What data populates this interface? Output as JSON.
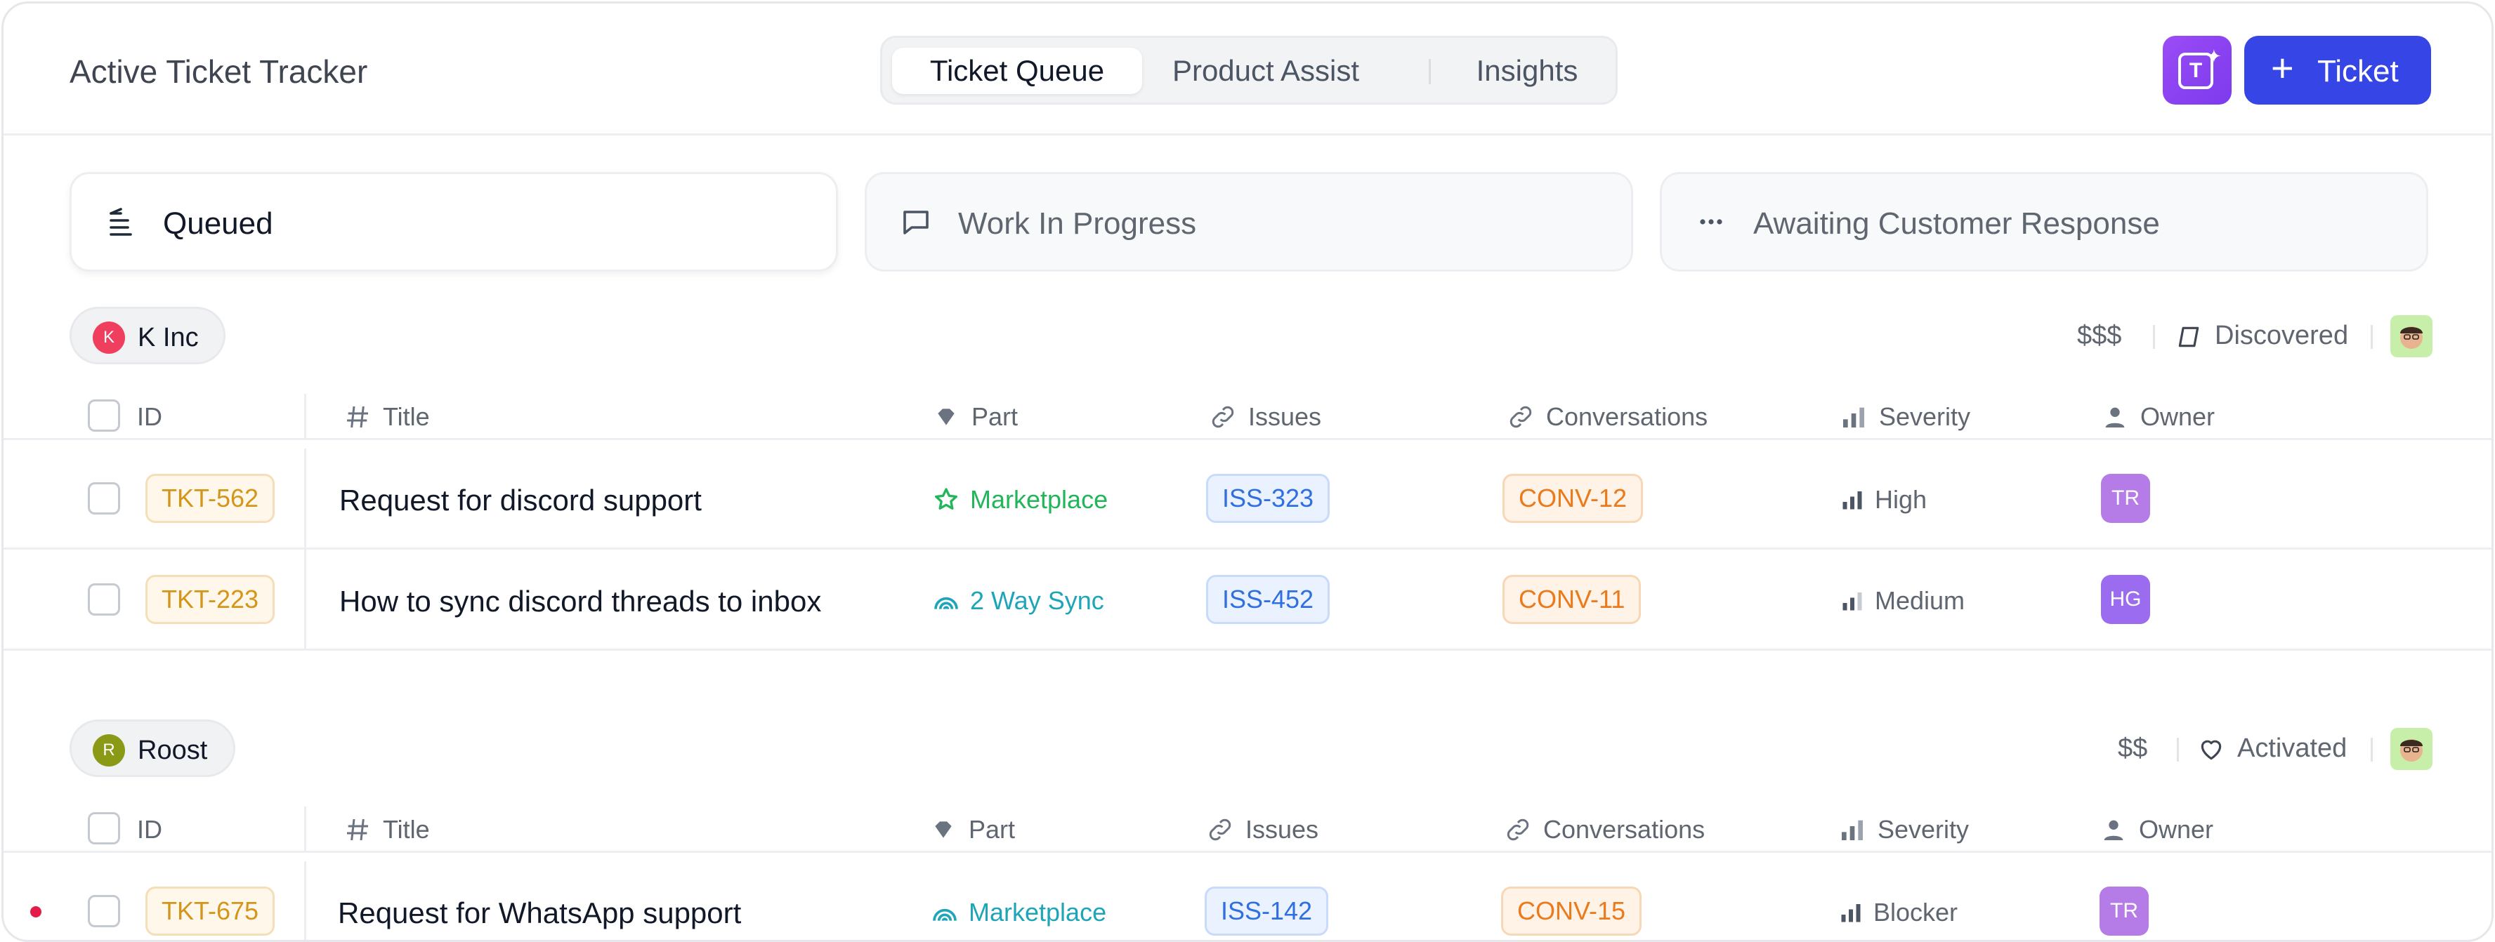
{
  "app_title": "Active Ticket Tracker",
  "tabs": [
    {
      "label": "Ticket Queue",
      "active": true
    },
    {
      "label": "Product Assist",
      "active": false
    },
    {
      "label": "Insights",
      "active": false
    }
  ],
  "ai_button": {
    "letter": "T",
    "icon": "sparkle-icon"
  },
  "new_ticket_button": {
    "icon": "plus-icon",
    "label": "Ticket"
  },
  "stages": [
    {
      "label": "Queued",
      "icon": "list-icon",
      "active": true
    },
    {
      "label": "Work In Progress",
      "icon": "chat-bubble-icon",
      "active": false
    },
    {
      "label": "Awaiting Customer Response",
      "icon": "ellipsis-icon",
      "active": false
    }
  ],
  "columns": [
    "ID",
    "Title",
    "Part",
    "Issues",
    "Conversations",
    "Severity",
    "Owner"
  ],
  "groups": [
    {
      "account": "K Inc",
      "avatar_letter": "K",
      "avatar_color": "#f03e5e",
      "tier": "$$$",
      "status": "Discovered",
      "status_icon": "tag-icon",
      "tickets": [
        {
          "id": "TKT-562",
          "title": "Request for discord support",
          "part": "Marketplace",
          "part_icon": "star-icon",
          "part_color": "#22b55a",
          "issue": "ISS-323",
          "conversation": "CONV-12",
          "severity": "High",
          "owner": "TR",
          "owner_color": "#b57be6"
        },
        {
          "id": "TKT-223",
          "title": "How to sync discord threads to inbox",
          "part": "2 Way Sync",
          "part_icon": "rainbow-icon",
          "part_color": "#1ea5b8",
          "issue": "ISS-452",
          "conversation": "CONV-11",
          "severity": "Medium",
          "owner": "HG",
          "owner_color": "#9c6cf0"
        }
      ]
    },
    {
      "account": "Roost",
      "avatar_letter": "R",
      "avatar_color": "#8a9a16",
      "tier": "$$",
      "status": "Activated",
      "status_icon": "heart-icon",
      "tickets": [
        {
          "id": "TKT-675",
          "title": "Request for WhatsApp support",
          "part": "Marketplace",
          "part_icon": "rainbow-icon",
          "part_color": "#1ea5b8",
          "issue": "ISS-142",
          "conversation": "CONV-15",
          "severity": "Blocker",
          "owner": "TR",
          "owner_color": "#b57be6",
          "unread": true
        }
      ]
    }
  ]
}
